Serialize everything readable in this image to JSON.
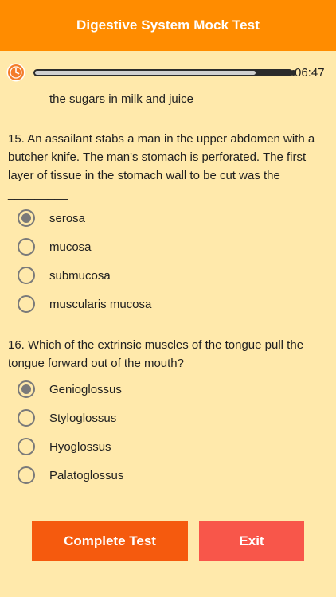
{
  "header": {
    "title": "Digestive System Mock Test"
  },
  "timer": {
    "icon": "alarm-clock-icon",
    "time": "06:47",
    "progress_fraction": 0.86
  },
  "previous": {
    "selected_option_text": "the sugars in milk and juice"
  },
  "questions": [
    {
      "text": "15. An assailant stabs a man in the upper abdomen with a butcher knife. The man's stomach is perforated. The first layer of tissue in the stomach wall to be cut was the _________",
      "options": [
        "serosa",
        "mucosa",
        "submucosa",
        "muscularis mucosa"
      ],
      "selected_index": 0
    },
    {
      "text": "16. Which of the extrinsic muscles of the tongue pull the tongue forward out of the mouth?",
      "options": [
        "Genioglossus",
        "Styloglossus",
        "Hyoglossus",
        "Palatoglossus"
      ],
      "selected_index": 0
    }
  ],
  "buttons": {
    "complete": "Complete Test",
    "exit": "Exit"
  },
  "colors": {
    "header": "#FF8C00",
    "background": "#FFE9AB",
    "complete_button": "#F55A0E",
    "exit_button": "#F8564A",
    "radio": "#7a7a7a"
  }
}
